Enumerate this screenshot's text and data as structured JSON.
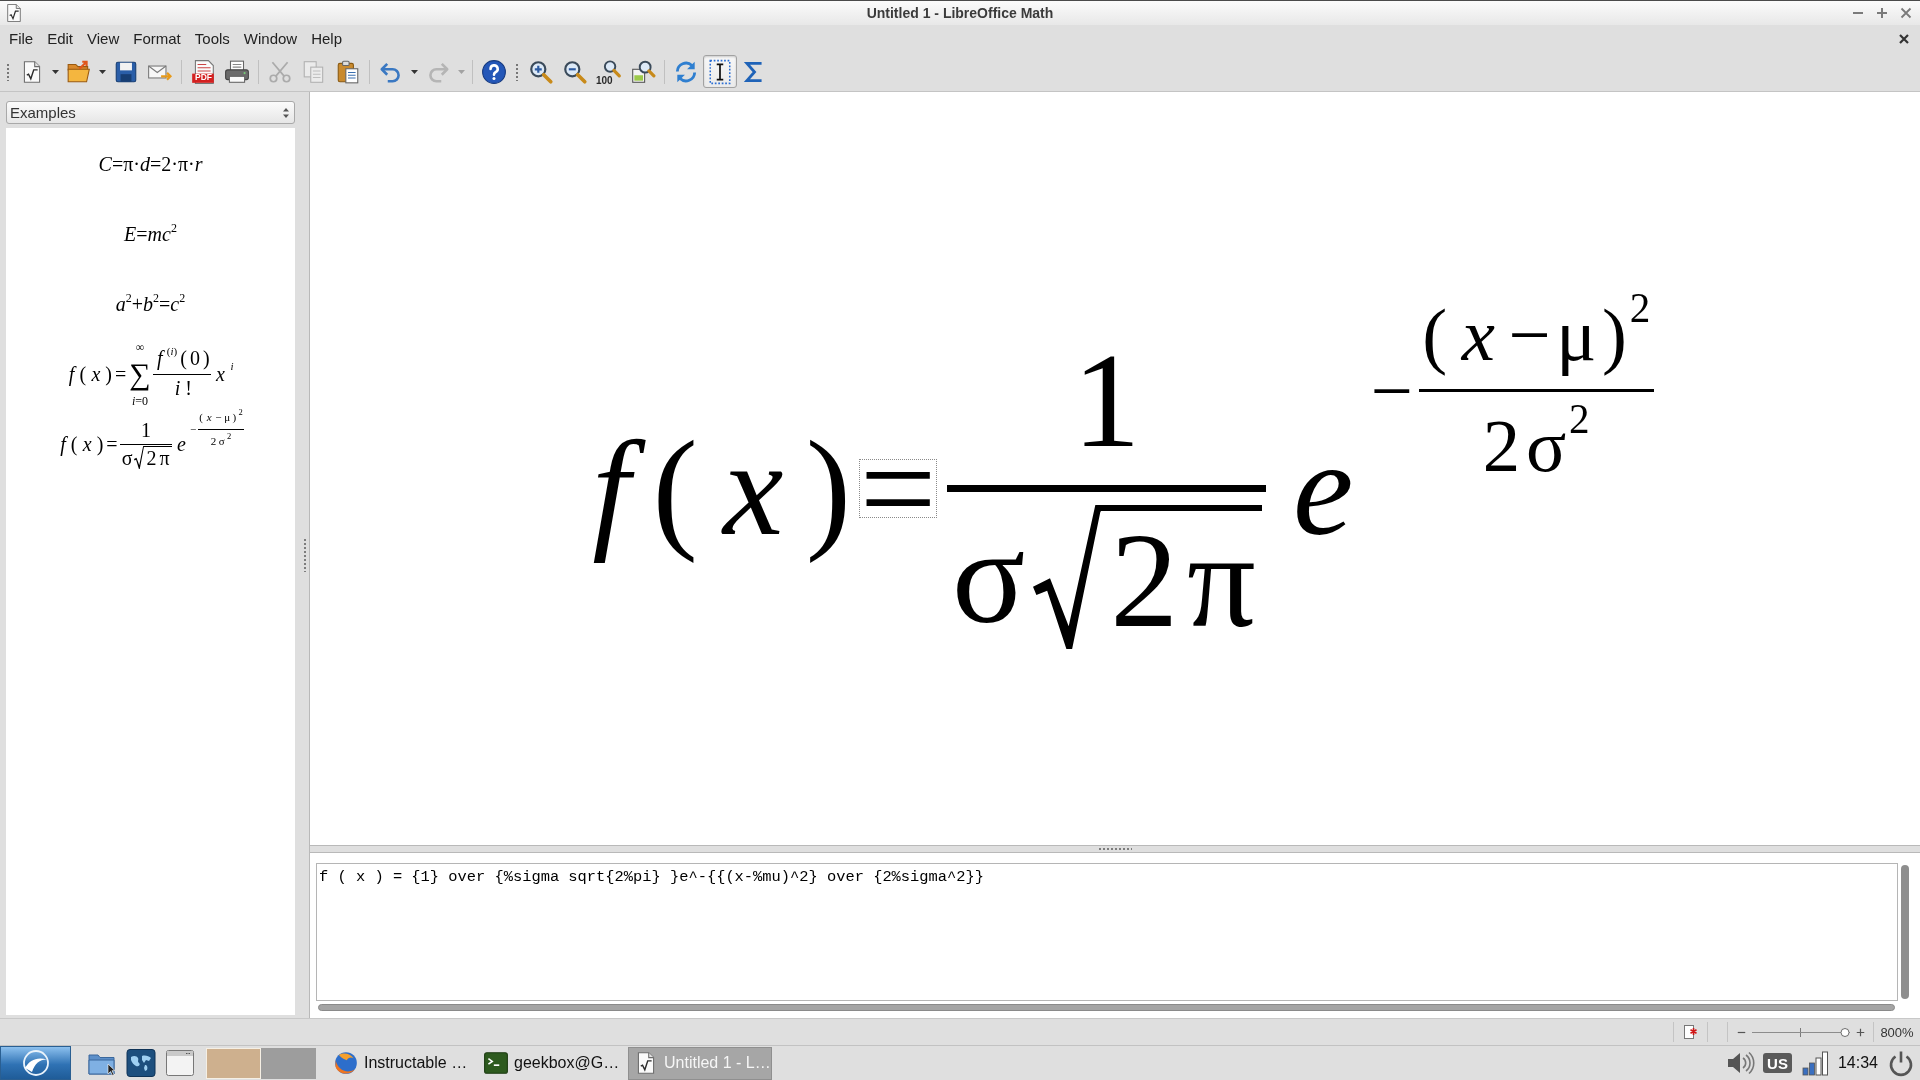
{
  "window": {
    "title": "Untitled 1 - LibreOffice Math"
  },
  "menu": [
    "File",
    "Edit",
    "View",
    "Format",
    "Tools",
    "Window",
    "Help"
  ],
  "toolbars": [
    {
      "groups": [
        [
          {
            "kind": "new",
            "dropdown": true,
            "disabled": false,
            "on": false
          },
          {
            "kind": "open",
            "dropdown": true,
            "disabled": false,
            "on": false
          },
          {
            "kind": "save",
            "dropdown": false,
            "disabled": false,
            "on": false
          },
          {
            "kind": "email",
            "dropdown": false,
            "disabled": false,
            "on": false
          }
        ],
        [
          {
            "kind": "pdf",
            "label": "PDF",
            "dropdown": false,
            "disabled": false,
            "on": false
          },
          {
            "kind": "print",
            "dropdown": false,
            "disabled": false,
            "on": false
          }
        ],
        [
          {
            "kind": "cut",
            "dropdown": false,
            "disabled": true,
            "on": false
          },
          {
            "kind": "copy",
            "dropdown": false,
            "disabled": true,
            "on": false
          },
          {
            "kind": "paste",
            "dropdown": false,
            "disabled": false,
            "on": false
          }
        ],
        [
          {
            "kind": "undo",
            "dropdown": true,
            "disabled": false,
            "on": false
          },
          {
            "kind": "redo",
            "dropdown": true,
            "disabled": true,
            "on": false
          }
        ],
        [
          {
            "kind": "help",
            "dropdown": false,
            "disabled": false,
            "on": false
          }
        ]
      ]
    },
    {
      "groups": [
        [
          {
            "kind": "zoom-in",
            "dropdown": false,
            "disabled": false,
            "on": false
          },
          {
            "kind": "zoom-out",
            "dropdown": false,
            "disabled": false,
            "on": false
          },
          {
            "kind": "zoom-100",
            "label": "100",
            "dropdown": false,
            "disabled": false,
            "on": false
          },
          {
            "kind": "zoom-page",
            "dropdown": false,
            "disabled": false,
            "on": false
          }
        ],
        [
          {
            "kind": "update",
            "dropdown": false,
            "disabled": false,
            "on": false
          },
          {
            "kind": "formula-cursor",
            "dropdown": false,
            "disabled": false,
            "on": true
          },
          {
            "kind": "elements",
            "dropdown": false,
            "disabled": false,
            "on": false
          }
        ]
      ]
    }
  ],
  "sidebar": {
    "dropdown": "Examples",
    "examples": [
      {
        "formula": [
          {
            "kind": "text",
            "text": "*C*=π·*d*=2·π·*r*"
          }
        ]
      },
      {
        "formula": [
          {
            "kind": "text",
            "text": "*E*=*mc*$^{2}$"
          }
        ]
      },
      {
        "formula": [
          {
            "kind": "text",
            "text": "*a*$^{2}$+*b*$^{2}$=*c*$^{2}$"
          }
        ]
      },
      {
        "formula": [
          {
            "kind": "variable",
            "text": "f"
          },
          {
            "kind": "text",
            "text": "("
          },
          {
            "kind": "variable",
            "text": "x"
          },
          {
            "kind": "text",
            "text": ")"
          },
          {
            "kind": "text",
            "text": "="
          },
          {
            "kind": "sum",
            "text": "∑",
            "over": [
              {
                "kind": "text",
                "text": "∞"
              }
            ],
            "under": [
              {
                "kind": "text",
                "text": "*i*=0"
              }
            ]
          },
          {
            "kind": "frac",
            "num": [
              {
                "kind": "sup",
                "base": [
                  {
                    "kind": "variable",
                    "text": "f"
                  }
                ],
                "exp": [
                  {
                    "kind": "text",
                    "text": "(*i*)"
                  }
                ]
              },
              {
                "kind": "text",
                "text": "("
              },
              {
                "kind": "text",
                "text": "0"
              },
              {
                "kind": "text",
                "text": ")"
              }
            ],
            "den": [
              {
                "kind": "variable",
                "text": "i"
              },
              {
                "kind": "text",
                "text": "!"
              }
            ]
          },
          {
            "kind": "sup",
            "base": [
              {
                "kind": "variable",
                "text": "x"
              }
            ],
            "exp": [
              {
                "kind": "variable",
                "text": "i"
              }
            ]
          }
        ]
      },
      {
        "formula": [
          {
            "kind": "variable",
            "text": "f"
          },
          {
            "kind": "text",
            "text": "("
          },
          {
            "kind": "variable",
            "text": "x"
          },
          {
            "kind": "text",
            "text": ")"
          },
          {
            "kind": "text",
            "text": "="
          },
          {
            "kind": "frac",
            "num": [
              {
                "kind": "text",
                "text": "1"
              }
            ],
            "den": [
              {
                "kind": "text",
                "text": "σ"
              },
              {
                "kind": "sqrt",
                "body": [
                  {
                    "kind": "text",
                    "text": "2"
                  },
                  {
                    "kind": "text",
                    "text": "π"
                  }
                ]
              }
            ]
          },
          {
            "kind": "sup",
            "base": [
              {
                "kind": "variable",
                "text": "e"
              }
            ],
            "exp": [
              {
                "kind": "text",
                "text": "−"
              },
              {
                "kind": "frac",
                "num": [
                  {
                    "kind": "sup",
                    "base": [
                      {
                        "kind": "text",
                        "text": "("
                      },
                      {
                        "kind": "variable",
                        "text": "x"
                      },
                      {
                        "kind": "text",
                        "text": "−"
                      },
                      {
                        "kind": "text",
                        "text": "μ"
                      },
                      {
                        "kind": "text",
                        "text": ")"
                      }
                    ],
                    "exp": [
                      {
                        "kind": "text",
                        "text": "2"
                      }
                    ]
                  }
                ],
                "den": [
                  {
                    "kind": "text",
                    "text": "2"
                  },
                  {
                    "kind": "sup",
                    "base": [
                      {
                        "kind": "text",
                        "text": "σ"
                      }
                    ],
                    "exp": [
                      {
                        "kind": "text",
                        "text": "2"
                      }
                    ]
                  }
                ]
              }
            ]
          }
        ]
      }
    ]
  },
  "canvas": {
    "formula": [
      {
        "kind": "variable",
        "text": "f",
        "selected": false
      },
      {
        "kind": "text",
        "text": "(",
        "selected": false
      },
      {
        "kind": "variable",
        "text": "x",
        "selected": false
      },
      {
        "kind": "text",
        "text": ")",
        "selected": false
      },
      {
        "kind": "text",
        "text": "=",
        "selected": true
      },
      {
        "kind": "frac",
        "num": [
          {
            "kind": "text",
            "text": "1",
            "selected": false
          }
        ],
        "den": [
          {
            "kind": "text",
            "text": "σ",
            "selected": false
          },
          {
            "kind": "sqrt",
            "body": [
              {
                "kind": "text",
                "text": "2",
                "selected": false
              },
              {
                "kind": "text",
                "text": "π",
                "selected": false
              }
            ]
          }
        ]
      },
      {
        "kind": "sup",
        "base": [
          {
            "kind": "variable",
            "text": "e",
            "selected": false
          }
        ],
        "exp": [
          {
            "kind": "text",
            "text": "−",
            "selected": false
          },
          {
            "kind": "frac",
            "num": [
              {
                "kind": "sup",
                "base": [
                  {
                    "kind": "text",
                    "text": "(",
                    "selected": false
                  },
                  {
                    "kind": "variable",
                    "text": "x",
                    "selected": false
                  },
                  {
                    "kind": "text",
                    "text": "−",
                    "selected": false
                  },
                  {
                    "kind": "text",
                    "text": "μ",
                    "selected": false
                  },
                  {
                    "kind": "text",
                    "text": ")",
                    "selected": false
                  }
                ],
                "exp": [
                  {
                    "kind": "text",
                    "text": "2",
                    "selected": false
                  }
                ]
              }
            ],
            "den": [
              {
                "kind": "text",
                "text": "2",
                "selected": false
              },
              {
                "kind": "sup",
                "base": [
                  {
                    "kind": "text",
                    "text": "σ",
                    "selected": false
                  }
                ],
                "exp": [
                  {
                    "kind": "text",
                    "text": "2",
                    "selected": false
                  }
                ]
              }
            ]
          }
        ]
      }
    ]
  },
  "command": {
    "value": "f ( x ) = {1} over {%sigma sqrt{2%pi} }e^-{{(x-%mu)^2} over {2%sigma^2}}"
  },
  "status_bar": {
    "modified": true,
    "zoom": {
      "level": 0.95,
      "reading": "800%"
    }
  },
  "taskbar": {
    "workspaces": [
      {
        "selected": true
      },
      {
        "selected": false
      }
    ],
    "tasks": [
      {
        "kind": "browser",
        "label": "Instructable …",
        "selected": false
      },
      {
        "kind": "terminal",
        "label": "geekbox@G…",
        "selected": false
      },
      {
        "kind": "math",
        "label": "Untitled 1 - L…",
        "selected": true
      }
    ],
    "keyboard": "US",
    "clock": "14:34"
  }
}
